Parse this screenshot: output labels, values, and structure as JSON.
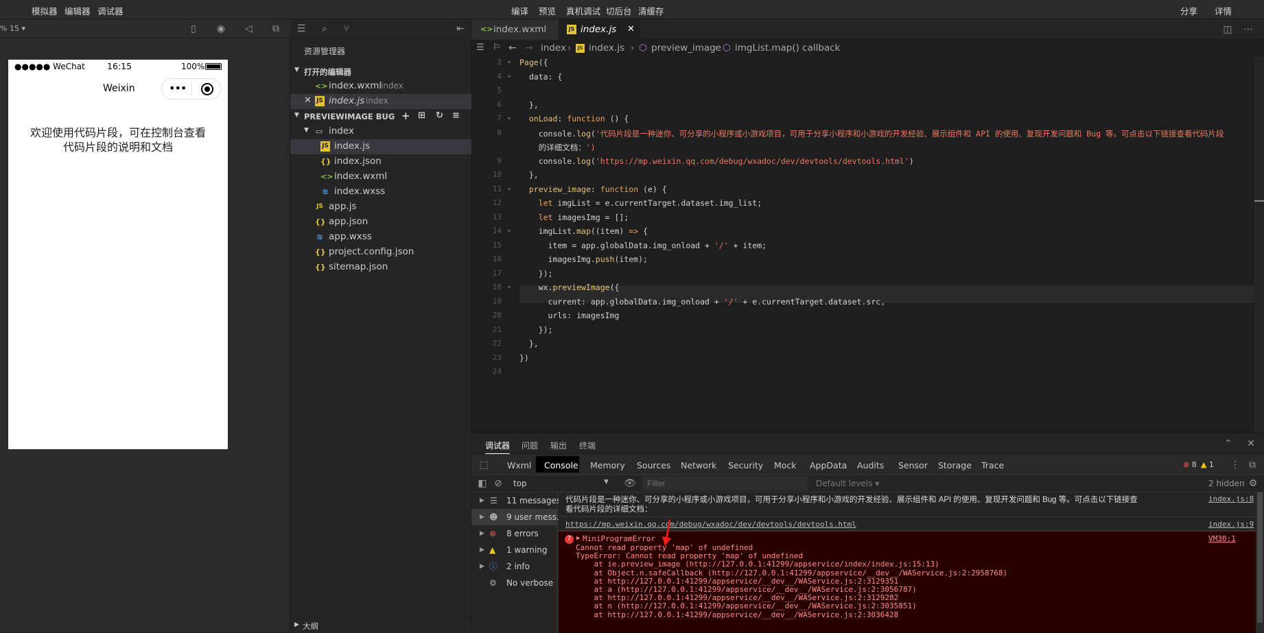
{
  "topbar": {
    "left_menu": [
      "模拟器",
      "编辑器",
      "调试器"
    ],
    "center_menu": [
      "编译",
      "预览",
      "真机调试",
      "切后台",
      "清缓存"
    ],
    "right_menu": [
      "分享",
      "详情"
    ]
  },
  "simulator": {
    "zoom": "% 15",
    "status": {
      "carrier": "●●●●● WeChat",
      "time": "16:15",
      "battery": "100%"
    },
    "nav_title": "Weixin",
    "content_text": "欢迎使用代码片段，可在控制台查看代码片段的说明和文档"
  },
  "explorer": {
    "title": "资源管理器",
    "open_editors_label": "打开的编辑器",
    "open_editors": [
      {
        "name": "index.wxml",
        "folder": "index"
      },
      {
        "name": "index.js",
        "folder": "index"
      }
    ],
    "project_label": "PREVIEWIMAGE BUG",
    "tree": [
      {
        "name": "index",
        "type": "folder"
      },
      {
        "name": "index.js",
        "type": "js"
      },
      {
        "name": "index.json",
        "type": "json"
      },
      {
        "name": "index.wxml",
        "type": "wxml"
      },
      {
        "name": "index.wxss",
        "type": "wxss"
      },
      {
        "name": "app.js",
        "type": "js"
      },
      {
        "name": "app.json",
        "type": "json"
      },
      {
        "name": "app.wxss",
        "type": "wxss"
      },
      {
        "name": "project.config.json",
        "type": "json"
      },
      {
        "name": "sitemap.json",
        "type": "json"
      }
    ],
    "outline_label": "大纲"
  },
  "editor": {
    "tabs": [
      {
        "label": "index.wxml"
      },
      {
        "label": "index.js"
      }
    ],
    "breadcrumb": [
      "index",
      "index.js",
      "preview_image",
      "imgList.map() callback"
    ],
    "lines": [
      {
        "n": "3",
        "text": "Page({"
      },
      {
        "n": "4",
        "text": "  data: {"
      },
      {
        "n": "5",
        "text": ""
      },
      {
        "n": "6",
        "text": "  },"
      },
      {
        "n": "7",
        "text": "  onLoad: function () {"
      },
      {
        "n": "8",
        "text": "    console.log('代码片段是一种迷你、可分享的小程序或小游戏项目，可用于分享小程序和小游戏的开发经验、展示组件和 API 的使用、复现开发问题和 Bug 等。可点击以下链接查看代码片段"
      },
      {
        "n": "",
        "text": "    的详细文档：')"
      },
      {
        "n": "9",
        "text": "    console.log('https://mp.weixin.qq.com/debug/wxadoc/dev/devtools/devtools.html')"
      },
      {
        "n": "10",
        "text": "  },"
      },
      {
        "n": "11",
        "text": "  preview_image: function (e) {"
      },
      {
        "n": "12",
        "text": "    let imgList = e.currentTarget.dataset.img_list;"
      },
      {
        "n": "13",
        "text": "    let imagesImg = [];"
      },
      {
        "n": "14",
        "text": "    imgList.map((item) => {"
      },
      {
        "n": "15",
        "text": "      item = app.globalData.img_onload + '/' + item;"
      },
      {
        "n": "16",
        "text": "      imagesImg.push(item);"
      },
      {
        "n": "17",
        "text": "    });"
      },
      {
        "n": "18",
        "text": "    wx.previewImage({"
      },
      {
        "n": "19",
        "text": "      current: app.globalData.img_onload + '/' + e.currentTarget.dataset.src,"
      },
      {
        "n": "20",
        "text": "      urls: imagesImg"
      },
      {
        "n": "21",
        "text": "    });"
      },
      {
        "n": "22",
        "text": "  },"
      },
      {
        "n": "23",
        "text": "})"
      },
      {
        "n": "24",
        "text": ""
      }
    ]
  },
  "panel": {
    "tabs": [
      "调试器",
      "问题",
      "输出",
      "终端"
    ],
    "devtools_tabs": [
      "Wxml",
      "Console",
      "Memory",
      "Sources",
      "Network",
      "Security",
      "Mock",
      "AppData",
      "Audits",
      "Sensor",
      "Storage",
      "Trace"
    ],
    "error_count": "8",
    "warning_count": "1",
    "context": "top",
    "filter_placeholder": "Filter",
    "levels": "Default levels ▾",
    "hidden": "2 hidden",
    "sidebar": [
      {
        "label": "11 messages"
      },
      {
        "label": "9 user mess..."
      },
      {
        "label": "8 errors"
      },
      {
        "label": "1 warning"
      },
      {
        "label": "2 info"
      },
      {
        "label": "No verbose"
      }
    ],
    "console_msg1_a": "代码片段是一种迷你、可分享的小程序或小游戏项目，可用于分享小程序和小游戏的开发经验、展示组件和 API 的使用、复现开发问题和 Bug 等。可点击以下链接查",
    "console_msg1_b": "看代码片段的详细文档：",
    "console_msg1_src": "index.js:8",
    "console_msg2": "https://mp.weixin.qq.com/debug/wxadoc/dev/devtools/devtools.html",
    "console_msg2_src": "index.js:9",
    "error_badge": "7",
    "error_title": "MiniProgramError",
    "error_src": "VM30:1",
    "error_lines": [
      "Cannot read property 'map' of undefined",
      "TypeError: Cannot read property 'map' of undefined",
      "    at ie.preview_image (http://127.0.0.1:41299/appservice/index/index.js:15:13)",
      "    at Object.n.safeCallback (http://127.0.0.1:41299/appservice/__dev__/WAService.js:2:2958768)",
      "    at http://127.0.0.1:41299/appservice/__dev__/WAService.js:2:3129351",
      "    at a (http://127.0.0.1:41299/appservice/__dev__/WAService.js:2:3056787)",
      "    at http://127.0.0.1:41299/appservice/__dev__/WAService.js:2:3129282",
      "    at n (http://127.0.0.1:41299/appservice/__dev__/WAService.js:2:3035851)",
      "    at http://127.0.0.1:41299/appservice/__dev__/WAService.js:2:3036428"
    ]
  }
}
